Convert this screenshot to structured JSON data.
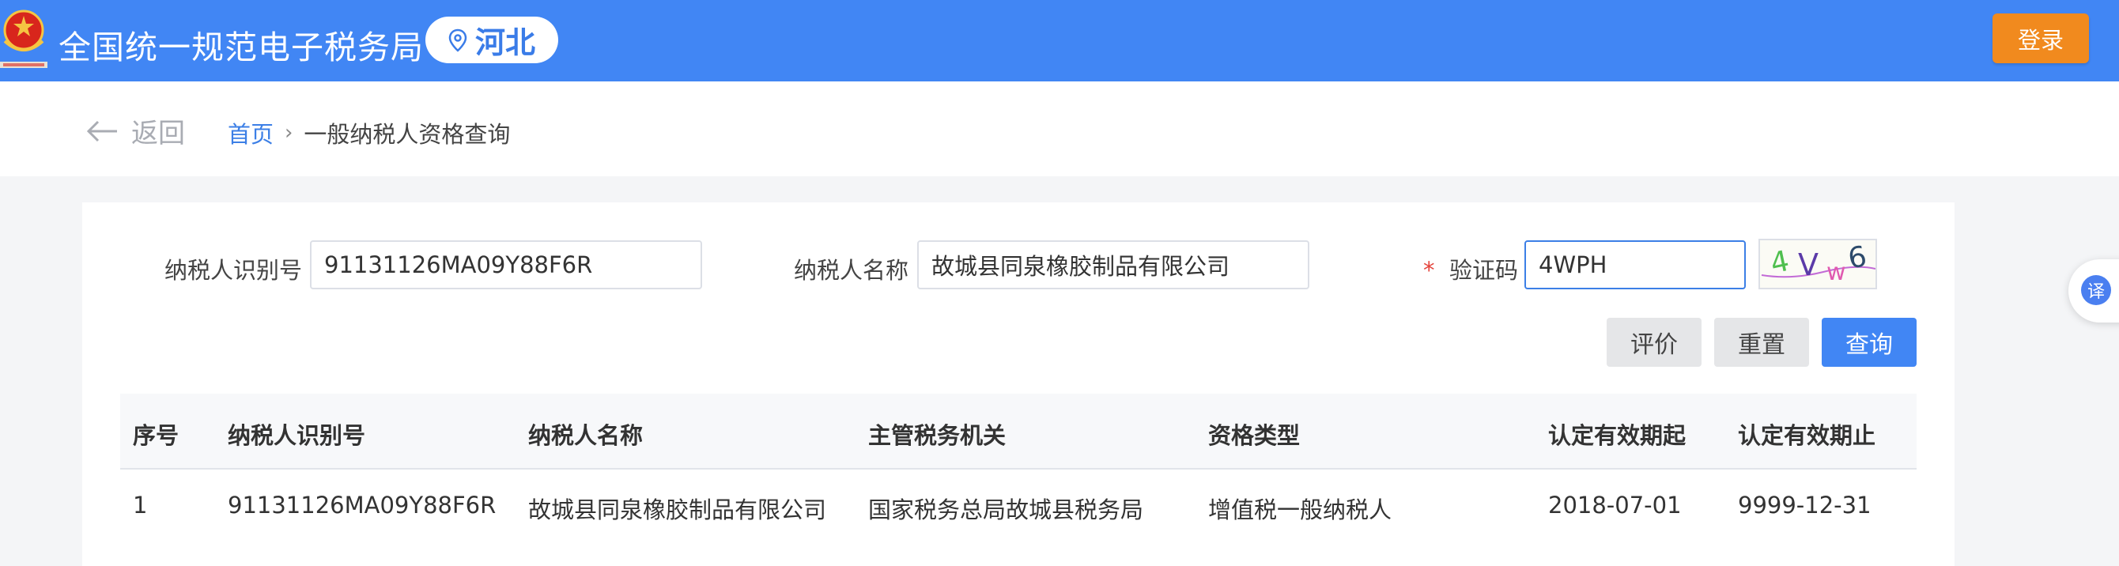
{
  "header": {
    "site_title": "全国统一规范电子税务局",
    "region": "河北",
    "login_label": "登录",
    "brand_color": "#4186f4"
  },
  "breadcrumb": {
    "back_label": "返回",
    "home": "首页",
    "current": "一般纳税人资格查询"
  },
  "form": {
    "taxpayer_id_label": "纳税人识别号",
    "taxpayer_id_value": "91131126MA09Y88F6R",
    "taxpayer_name_label": "纳税人名称",
    "taxpayer_name_value": "故城县同泉橡胶制品有限公司",
    "captcha_required_mark": "*",
    "captcha_label": "验证码",
    "captcha_value": "4WPH",
    "captcha_image_text": "4Vw6"
  },
  "buttons": {
    "evaluate": "评价",
    "reset": "重置",
    "query": "查询"
  },
  "table": {
    "headers": [
      "序号",
      "纳税人识别号",
      "纳税人名称",
      "主管税务机关",
      "资格类型",
      "认定有效期起",
      "认定有效期止"
    ],
    "rows": [
      [
        "1",
        "91131126MA09Y88F6R",
        "故城县同泉橡胶制品有限公司",
        "国家税务总局故城县税务局",
        "增值税一般纳税人",
        "2018-07-01",
        "9999-12-31"
      ]
    ]
  },
  "float": {
    "translate_label": "译"
  }
}
